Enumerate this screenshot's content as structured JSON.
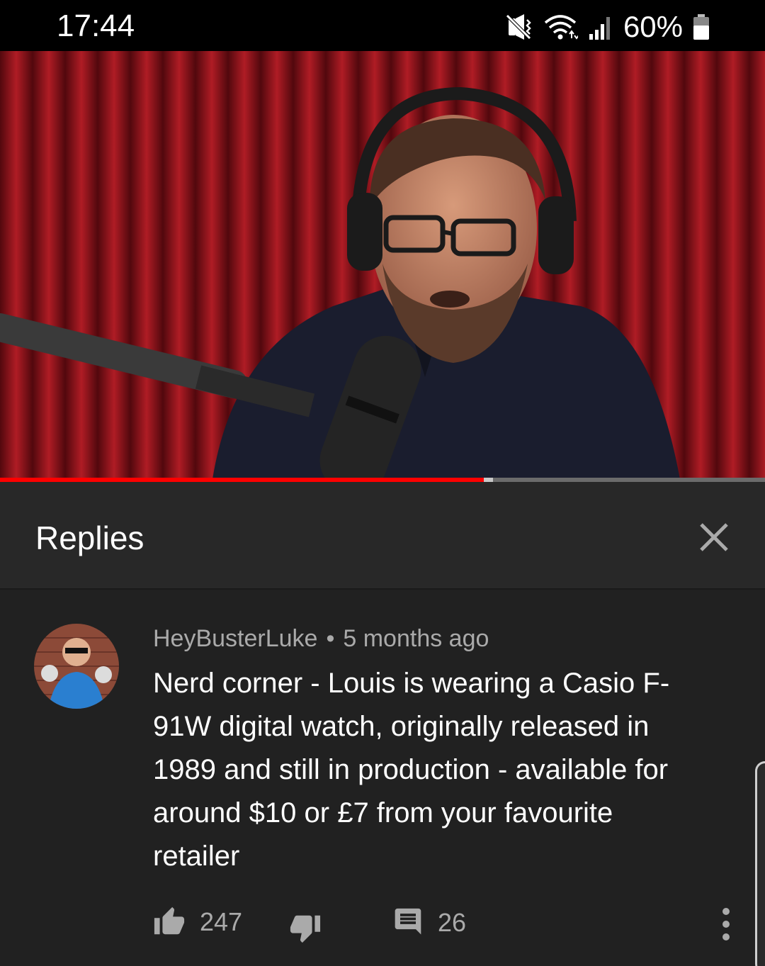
{
  "status_bar": {
    "time": "17:44",
    "battery": "60%",
    "icons": [
      "mute-vibrate-icon",
      "wifi-icon",
      "signal-icon",
      "battery-icon"
    ]
  },
  "video": {
    "progress_fraction": 0.632,
    "buffered_fraction": 0.644,
    "colors": {
      "played": "#ff0000",
      "buffered": "#c8c8c8",
      "track": "#6b6b6b"
    }
  },
  "replies_panel": {
    "title": "Replies",
    "close_icon": "close-icon"
  },
  "comment": {
    "author": "HeyBusterLuke",
    "separator": "•",
    "time_ago": "5 months ago",
    "text": "Nerd corner - Louis is wearing a Casio F-91W digital watch, originally released in 1989 and still in production - available for around $10 or £7 from your favourite retailer",
    "likes": "247",
    "replies": "26",
    "icons": {
      "like": "thumbs-up-icon",
      "dislike": "thumbs-down-icon",
      "reply": "comment-icon",
      "more": "more-vertical-icon"
    }
  }
}
